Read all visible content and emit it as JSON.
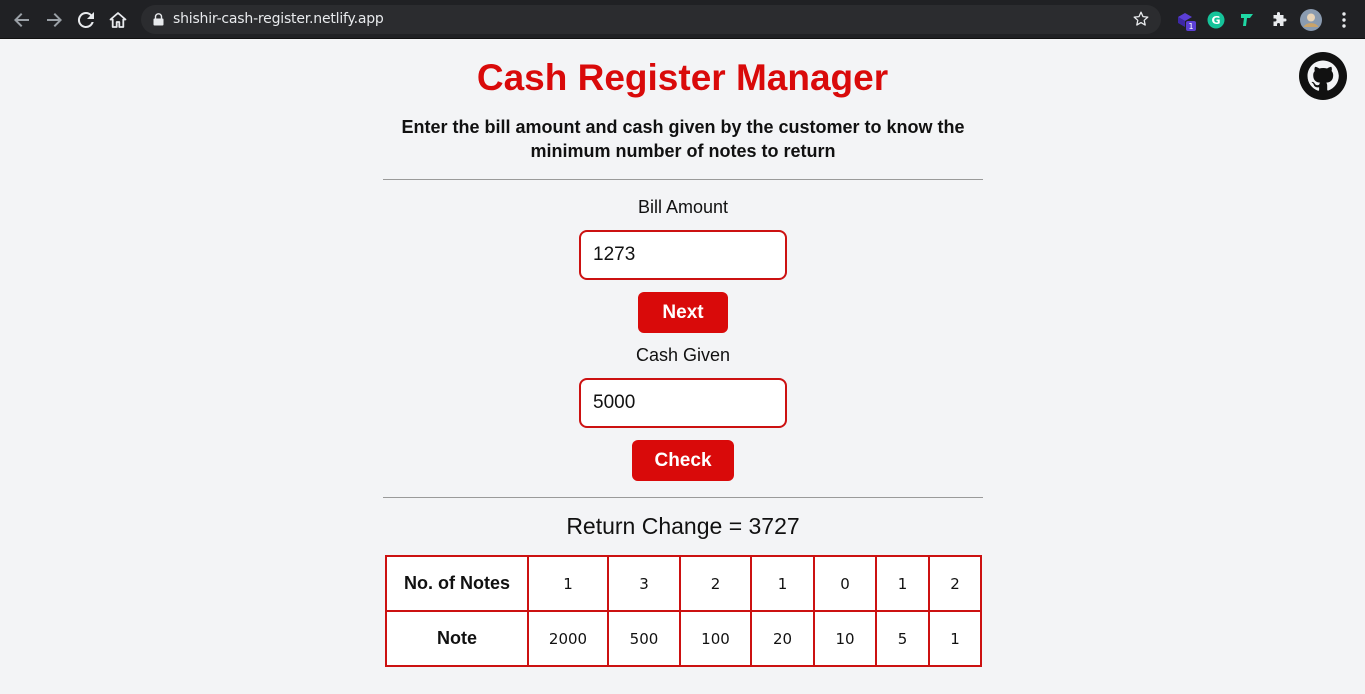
{
  "browser": {
    "url": "shishir-cash-register.netlify.app",
    "extension_badge": "1",
    "extension_g": "G"
  },
  "page": {
    "title": "Cash Register Manager",
    "subtitle": "Enter the bill amount and cash given by the customer to know the minimum number of notes to return",
    "bill_label": "Bill Amount",
    "bill_value": "1273",
    "next_label": "Next",
    "cash_label": "Cash Given",
    "cash_value": "5000",
    "check_label": "Check",
    "result_text": "Return Change = 3727"
  },
  "table": {
    "row1_header": "No. of Notes",
    "row2_header": "Note",
    "counts": [
      "1",
      "3",
      "2",
      "1",
      "0",
      "1",
      "2"
    ],
    "notes": [
      "2000",
      "500",
      "100",
      "20",
      "10",
      "5",
      "1"
    ]
  },
  "colors": {
    "accent": "#d90a0a",
    "background": "#f3f4f6"
  }
}
